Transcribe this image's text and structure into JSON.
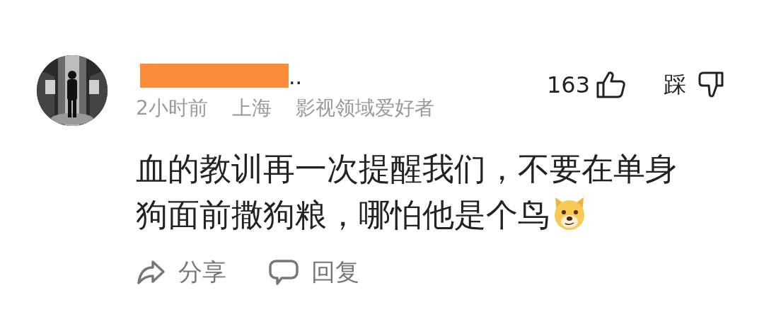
{
  "comment": {
    "author": {
      "name_visible": "..",
      "redacted": true
    },
    "time": "2小时前",
    "location": "上海",
    "badge": "影视领域爱好者",
    "likes": "163",
    "dislike_label": "踩",
    "text": "血的教训再一次提醒我们，不要在单身狗面前撒狗粮，哪怕他是个鸟",
    "actions": [
      {
        "kind": "share",
        "label": "分享"
      },
      {
        "kind": "reply",
        "label": "回复"
      }
    ]
  }
}
